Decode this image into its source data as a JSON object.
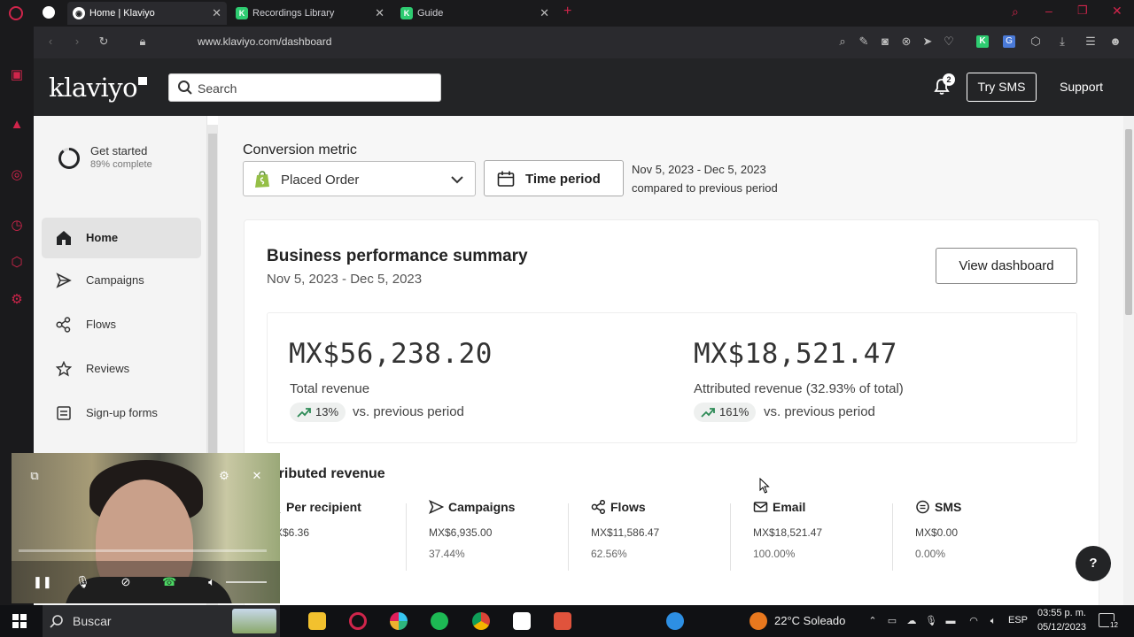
{
  "browser": {
    "tabs": [
      {
        "title": "Home | Klaviyo",
        "active": true
      },
      {
        "title": "Recordings Library",
        "active": false
      },
      {
        "title": "Guide",
        "active": false
      }
    ],
    "url": "www.klaviyo.com/dashboard",
    "add_tab": "+"
  },
  "header": {
    "logo": "klaviyo",
    "search_placeholder": "Search",
    "notifications_count": "2",
    "try_sms": "Try SMS",
    "support": "Support"
  },
  "sidebar": {
    "get_started_title": "Get started",
    "get_started_sub": "89% complete",
    "get_started_progress": 0.89,
    "items": [
      {
        "label": "Home",
        "icon": "home-icon",
        "active": true
      },
      {
        "label": "Campaigns",
        "icon": "send-icon",
        "active": false
      },
      {
        "label": "Flows",
        "icon": "flows-icon",
        "active": false
      },
      {
        "label": "Reviews",
        "icon": "star-icon",
        "active": false
      },
      {
        "label": "Sign-up forms",
        "icon": "form-icon",
        "active": false
      }
    ]
  },
  "filters": {
    "conversion_label": "Conversion metric",
    "metric_value": "Placed Order",
    "time_period_label": "Time period",
    "date_range": "Nov 5, 2023 - Dec 5, 2023",
    "compare_text": "compared to previous period"
  },
  "summary": {
    "title": "Business performance summary",
    "date": "Nov 5, 2023 - Dec 5, 2023",
    "view_dashboard": "View dashboard",
    "total_revenue": {
      "value": "MX$56,238.20",
      "label": "Total revenue",
      "change": "13%",
      "vs": "vs. previous period"
    },
    "attributed_revenue": {
      "value": "MX$18,521.47",
      "label": "Attributed revenue (32.93% of total)",
      "change": "161%",
      "vs": "vs. previous period"
    }
  },
  "attributed": {
    "title": "ttributed revenue",
    "columns": [
      {
        "head": "Per recipient",
        "value": "MX$6.36",
        "pct": ""
      },
      {
        "head": "Campaigns",
        "value": "MX$6,935.00",
        "pct": "37.44%"
      },
      {
        "head": "Flows",
        "value": "MX$11,586.47",
        "pct": "62.56%"
      },
      {
        "head": "Email",
        "value": "MX$18,521.47",
        "pct": "100.00%"
      },
      {
        "head": "SMS",
        "value": "MX$0.00",
        "pct": "0.00%"
      }
    ]
  },
  "help": "?",
  "taskbar": {
    "search_placeholder": "Buscar",
    "weather": "22°C Soleado",
    "lang": "ESP",
    "time": "03:55 p. m.",
    "date": "05/12/2023",
    "notif_count": "12"
  },
  "colors": {
    "klaviyo_dark": "#232426",
    "opera_red": "#d0254b",
    "trend_green": "#2e8b57",
    "shopify_green": "#95bf47"
  }
}
